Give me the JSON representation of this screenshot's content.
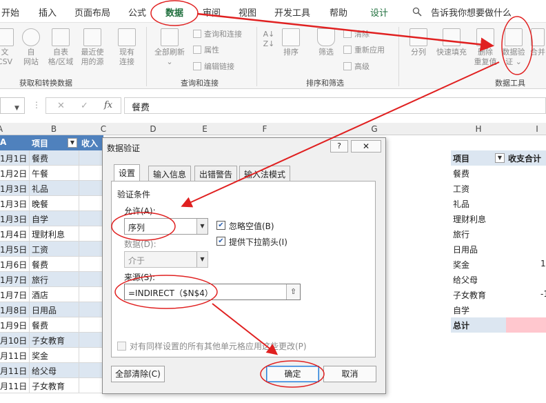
{
  "menu": {
    "tabs": [
      {
        "label": "开始"
      },
      {
        "label": "插入"
      },
      {
        "label": "页面布局"
      },
      {
        "label": "公式"
      },
      {
        "label": "数据"
      },
      {
        "label": "审阅"
      },
      {
        "label": "视图"
      },
      {
        "label": "开发工具"
      },
      {
        "label": "帮助"
      },
      {
        "label": "设计"
      }
    ],
    "tellme": "告诉我你想要做什么"
  },
  "ribbon": {
    "get_data": {
      "buttons": [
        {
          "line1": "文",
          "line2": "CSV"
        },
        {
          "line1": "自",
          "line2": "网站"
        },
        {
          "line1": "自表",
          "line2": "格/区域"
        },
        {
          "line1": "最近使",
          "line2": "用的源"
        },
        {
          "line1": "现有",
          "line2": "连接"
        }
      ],
      "group_label": "获取和转换数据"
    },
    "queries": {
      "refresh_line1": "全部刷新",
      "refresh_line2": "⌄",
      "small": [
        "查询和连接",
        "属性",
        "编辑链接"
      ],
      "group_label": "查询和连接"
    },
    "sort_filter": {
      "sort_label": "排序",
      "filter_label": "筛选",
      "small": [
        "清除",
        "重新应用",
        "高级"
      ],
      "group_label": "排序和筛选"
    },
    "data_tools": {
      "split_label": "分列",
      "flash_label": "快速填充",
      "remove_line1": "删除",
      "remove_line2": "重复值",
      "validate_line1": "数据验",
      "validate_line2": "证 ⌄",
      "merge_label": "合并",
      "group_label": "数据工具"
    }
  },
  "formula_bar": {
    "value": "餐费"
  },
  "columns": [
    "A",
    "B",
    "C",
    "D",
    "E",
    "F",
    "G",
    "H",
    "I"
  ],
  "left_table": {
    "header": {
      "date": "A",
      "item": "项目",
      "income": "收入"
    },
    "rows": [
      {
        "date": "1月1日",
        "item": "餐费"
      },
      {
        "date": "1月2日",
        "item": "午餐"
      },
      {
        "date": "1月3日",
        "item": "礼品"
      },
      {
        "date": "1月3日",
        "item": "晚餐"
      },
      {
        "date": "1月3日",
        "item": "自学"
      },
      {
        "date": "1月4日",
        "item": "理财利息"
      },
      {
        "date": "1月5日",
        "item": "工资"
      },
      {
        "date": "1月6日",
        "item": "餐费"
      },
      {
        "date": "1月7日",
        "item": "旅行"
      },
      {
        "date": "1月7日",
        "item": "酒店"
      },
      {
        "date": "1月8日",
        "item": "日用品"
      },
      {
        "date": "1月9日",
        "item": "餐费"
      },
      {
        "date": "月10日",
        "item": "子女教育"
      },
      {
        "date": "月11日",
        "item": "奖金"
      },
      {
        "date": "月11日",
        "item": "给父母"
      },
      {
        "date": "月11日",
        "item": "子女教育"
      }
    ]
  },
  "pivot": {
    "header_item": "项目",
    "header_sum": "收支合计",
    "rows": [
      {
        "label": "餐费",
        "value": ""
      },
      {
        "label": "工资",
        "value": ""
      },
      {
        "label": "礼品",
        "value": ""
      },
      {
        "label": "理财利息",
        "value": ""
      },
      {
        "label": "旅行",
        "value": ""
      },
      {
        "label": "日用品",
        "value": ""
      },
      {
        "label": "奖金",
        "value": "1"
      },
      {
        "label": "给父母",
        "value": ""
      },
      {
        "label": "子女教育",
        "value": "-1"
      },
      {
        "label": "自学",
        "value": ""
      }
    ],
    "total_label": "总计"
  },
  "dialog": {
    "title": "数据验证",
    "help": "?",
    "close": "✕",
    "tabs": [
      "设置",
      "输入信息",
      "出错警告",
      "输入法模式"
    ],
    "section_label": "验证条件",
    "allow_label": "允许(A):",
    "allow_value": "序列",
    "ignore_blank_label": "忽略空值(B)",
    "dropdown_label": "提供下拉箭头(I)",
    "data_label": "数据(D):",
    "data_value": "介于",
    "source_label": "来源(S):",
    "source_value": "=INDIRECT（$N$4）",
    "apply_all_label": "对有同样设置的所有其他单元格应用这些更改(P)",
    "clear_all": "全部清除(C)",
    "ok": "确定",
    "cancel": "取消"
  },
  "colors": {
    "annotation_red": "#e02020",
    "table_header_blue": "#4f81bd",
    "banded_row": "#dce6f1",
    "active_tab_green": "#1e6e3c",
    "total_pink": "#ffc7ce"
  }
}
